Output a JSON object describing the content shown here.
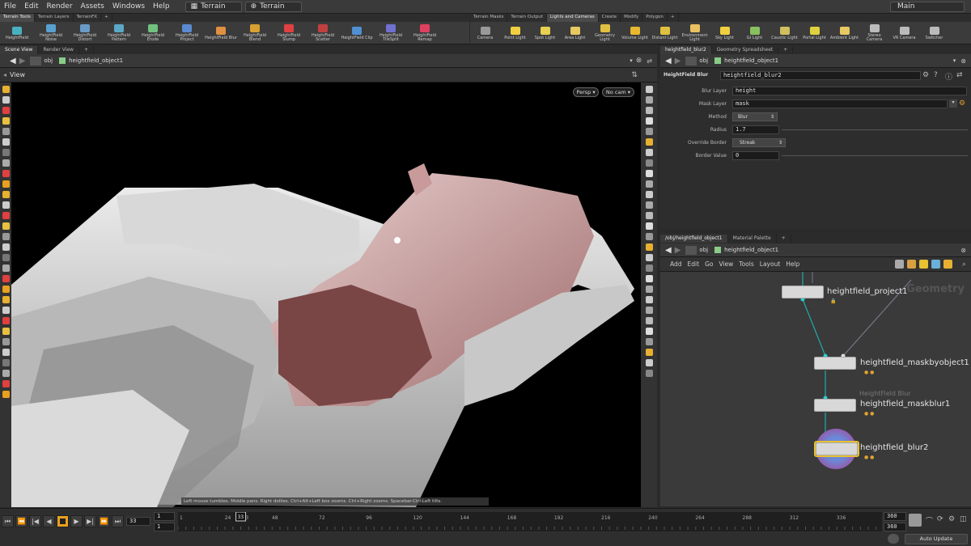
{
  "menu": [
    "File",
    "Edit",
    "Render",
    "Assets",
    "Windows",
    "Help"
  ],
  "desktop_label": "Terrain",
  "desktop2_label": "Terrain",
  "main_label": "Main",
  "shelf_left_tabs": [
    "Terrain Tools",
    "Terrain Layers",
    "TerrainFX"
  ],
  "shelf_left_tools": [
    "HeightField",
    "HeightField Noise",
    "HeightField Distort",
    "HeightField Pattern",
    "HeightField Erode",
    "HeightField Project",
    "HeightField Blur",
    "HeightField Blend",
    "HeightField Slump",
    "HeightField Scatter",
    "HeightField Clip",
    "HeightField TileSplit",
    "HeightField Remap"
  ],
  "shelf_right_tabs": [
    "Terrain Masks",
    "Terrain Output",
    "Lights and Cameras",
    "Create",
    "Modify",
    "Polygon"
  ],
  "shelf_right_tools": [
    "Camera",
    "Point Light",
    "Spot Light",
    "Area Light",
    "Geometry Light",
    "Volume Light",
    "Distant Light",
    "Environment Light",
    "Sky Light",
    "GI Light",
    "Caustic Light",
    "Portal Light",
    "Ambient Light",
    "Stereo Camera",
    "VR Camera",
    "Switcher"
  ],
  "left_tabs": [
    "Scene View",
    "Render View"
  ],
  "path_obj": "obj",
  "path_node": "heightfield_object1",
  "view_label": "View",
  "persp_label": "Persp",
  "cam_label": "No cam",
  "status_hint": "Left mouse tumbles. Middle pans. Right dollies. Ctrl+Alt+Left box zooms. Ctrl+Right zooms. Spacebar-Ctrl-Left tilts.",
  "param_tabs": [
    "heightfield_blur2",
    "Geometry Spreadsheet"
  ],
  "param_node_type": "HeightField Blur",
  "param_node_name": "heightfield_blur2",
  "params": [
    {
      "label": "Blur Layer",
      "value": "height"
    },
    {
      "label": "Mask Layer",
      "value": "mask"
    },
    {
      "label": "Method",
      "value": "Blur"
    },
    {
      "label": "Radius",
      "value": "1.7"
    },
    {
      "label": "Override Border",
      "value": "Streak"
    },
    {
      "label": "Border Value",
      "value": "0"
    }
  ],
  "network_tabs": [
    "/obj/heightfield_object1",
    "Material Palette"
  ],
  "network_menu": [
    "Add",
    "Edit",
    "Go",
    "View",
    "Tools",
    "Layout",
    "Help"
  ],
  "network_watermark": "Geometry",
  "nodes": [
    {
      "name": "heightfield_project1"
    },
    {
      "name": "heightfield_maskbyobject1"
    },
    {
      "name": "heightfield_maskblur1",
      "type_label": "HeightField Blur"
    },
    {
      "name": "heightfield_blur2"
    }
  ],
  "timeline": {
    "current_frame": "33",
    "start": "1",
    "start2": "1",
    "end": "360",
    "end2": "360",
    "ticks": [
      "1",
      "24",
      "33",
      "48",
      "72",
      "96",
      "120",
      "144",
      "168",
      "192",
      "216",
      "240",
      "264",
      "288",
      "312",
      "336"
    ],
    "auto_update": "Auto Update"
  }
}
